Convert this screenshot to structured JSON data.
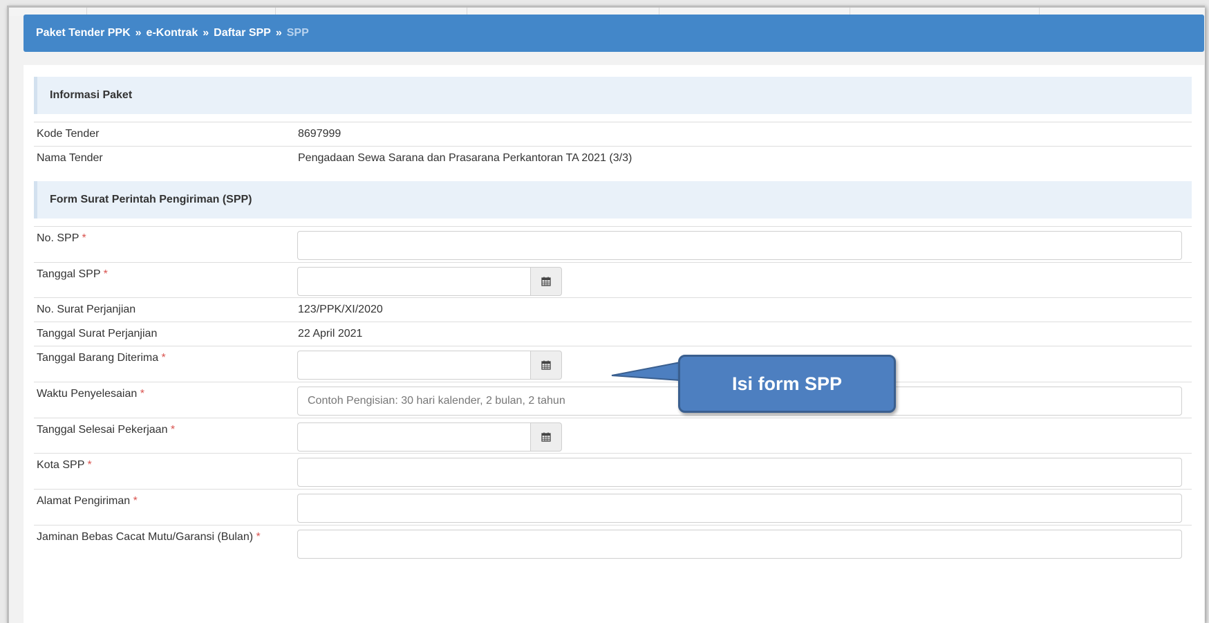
{
  "breadcrumb": {
    "items": [
      "Paket Tender PPK",
      "e-Kontrak",
      "Daftar SPP"
    ],
    "current": "SPP",
    "separator": "»"
  },
  "info_section": {
    "title": "Informasi Paket",
    "rows": [
      {
        "label": "Kode Tender",
        "value": "8697999"
      },
      {
        "label": "Nama Tender",
        "value": "Pengadaan Sewa Sarana dan Prasarana Perkantoran TA 2021 (3/3)"
      }
    ]
  },
  "form_section": {
    "title": "Form Surat Perintah Pengiriman (SPP)",
    "required_mark": "*",
    "fields": {
      "no_spp": {
        "label": "No. SPP",
        "value": ""
      },
      "tanggal_spp": {
        "label": "Tanggal SPP",
        "value": ""
      },
      "no_surat_perjanjian": {
        "label": "No. Surat Perjanjian",
        "value": "123/PPK/XI/2020"
      },
      "tanggal_surat_perjanjian": {
        "label": "Tanggal Surat Perjanjian",
        "value": "22 April 2021"
      },
      "tanggal_barang_diterima": {
        "label": "Tanggal Barang Diterima",
        "value": ""
      },
      "waktu_penyelesaian": {
        "label": "Waktu Penyelesaian",
        "value": "",
        "placeholder": "Contoh Pengisian: 30 hari kalender, 2 bulan, 2 tahun"
      },
      "tanggal_selesai_pekerjaan": {
        "label": "Tanggal Selesai Pekerjaan",
        "value": ""
      },
      "kota_spp": {
        "label": "Kota SPP",
        "value": ""
      },
      "alamat_pengiriman": {
        "label": "Alamat Pengiriman",
        "value": ""
      },
      "jaminan": {
        "label": "Jaminan Bebas Cacat Mutu/Garansi (Bulan)",
        "value": ""
      }
    }
  },
  "callout": {
    "text": "Isi form SPP"
  },
  "icons": {
    "calendar": "calendar-icon"
  },
  "colors": {
    "breadcrumb_bg": "#4387c9",
    "breadcrumb_current": "#b9d3ee",
    "section_bg": "#e9f1f9",
    "required": "#d9534f",
    "callout_bg": "#4d7fc0"
  }
}
